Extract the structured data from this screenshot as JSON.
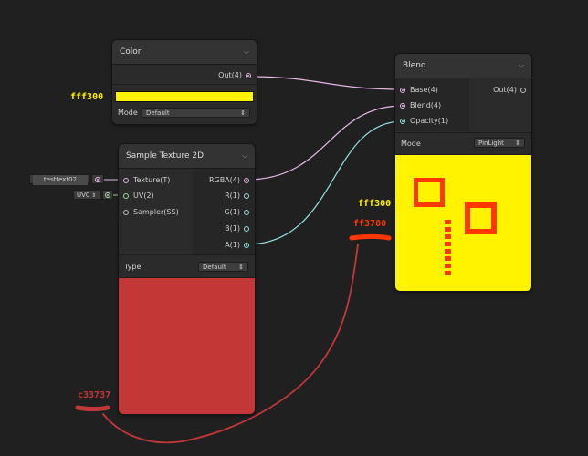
{
  "colors": {
    "background": "#202020",
    "color_swatch": "#fff300",
    "texture_preview": "#c33737",
    "blend_preview": "#fff300",
    "blend_squares": "#ff3700",
    "annotation_yellow": "#fff300",
    "annotation_orange": "#ff3700",
    "annotation_red": "#c33737",
    "wire_pink": "#e6b6e6",
    "wire_cyan": "#8fe3e3"
  },
  "color_node": {
    "title": "Color",
    "output": "Out(4)",
    "mode_label": "Mode",
    "mode_value": "Default"
  },
  "sample_texture_node": {
    "title": "Sample Texture 2D",
    "inputs": [
      "Texture(T)",
      "UV(2)",
      "Sampler(SS)"
    ],
    "outputs": [
      "RGBA(4)",
      "R(1)",
      "G(1)",
      "B(1)",
      "A(1)"
    ],
    "type_label": "Type",
    "type_value": "Default",
    "texture_field": "testtext02",
    "uv_field": "UV0"
  },
  "blend_node": {
    "title": "Blend",
    "inputs": [
      "Base(4)",
      "Blend(4)",
      "Opacity(1)"
    ],
    "output": "Out(4)",
    "mode_label": "Mode",
    "mode_value": "PinLight"
  },
  "annotations": {
    "color_hex": "fff300",
    "blend_hex_1": "fff300",
    "blend_hex_2": "ff3700",
    "texture_hex": "c33737"
  }
}
